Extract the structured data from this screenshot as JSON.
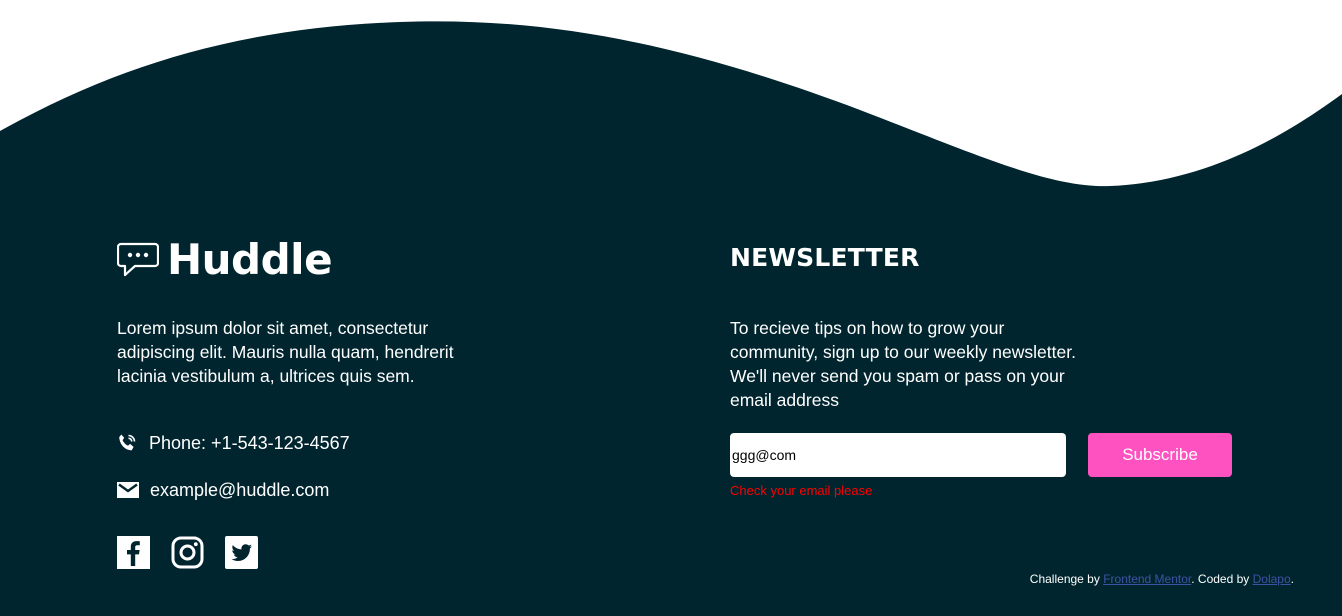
{
  "colors": {
    "background_top": "#ffffff",
    "footer_bg": "#00252e",
    "text": "#ffffff",
    "accent_pink": "#ff52c1",
    "error_red": "#ff0000",
    "link_blue": "#3e52a3"
  },
  "brand": {
    "name": "Huddle",
    "icon": "chat-bubble-icon"
  },
  "description": "Lorem ipsum dolor sit amet, consectetur adipiscing elit. Mauris nulla quam, hendrerit lacinia vestibulum a, ultrices quis sem.",
  "contact": {
    "phone": {
      "icon": "phone-icon",
      "text": "Phone: +1-543-123-4567"
    },
    "email": {
      "icon": "email-icon",
      "text": "example@huddle.com"
    }
  },
  "socials": [
    {
      "name": "facebook-icon"
    },
    {
      "name": "instagram-icon"
    },
    {
      "name": "twitter-icon"
    }
  ],
  "newsletter": {
    "title": "NEWSLETTER",
    "text": "To recieve tips on how to grow your community, sign up to our weekly newsletter. We'll never send you spam or pass on your email address",
    "input_value": "ggg@com",
    "button_label": "Subscribe",
    "error": "Check your email please"
  },
  "credit": {
    "prefix": "Challenge by ",
    "link1": "Frontend Mentor",
    "middle": ". Coded by ",
    "link2": "Dolapo",
    "suffix": "."
  }
}
